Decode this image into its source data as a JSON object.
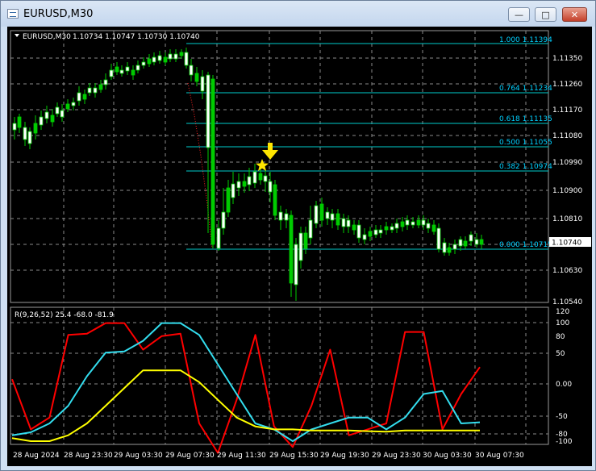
{
  "window": {
    "title": "EURUSD,M30",
    "minimize_icon": "minimize-icon",
    "maximize_icon": "maximize-icon",
    "close_icon": "close-icon"
  },
  "chart": {
    "symbol_header": "EURUSD,M30",
    "ohlc": "1.10734 1.10747 1.10730 1.10740",
    "current_price": "1.10740",
    "price_ticks": [
      "1.11350",
      "1.11260",
      "1.11170",
      "1.11080",
      "1.10990",
      "1.10900",
      "1.10810",
      "1.10720",
      "1.10630",
      "1.10540"
    ],
    "time_ticks": [
      "28 Aug 2024",
      "28 Aug 23:30",
      "29 Aug 03:30",
      "29 Aug 07:30",
      "29 Aug 11:30",
      "29 Aug 15:30",
      "29 Aug 19:30",
      "29 Aug 23:30",
      "30 Aug 03:30",
      "30 Aug 07:30"
    ],
    "fibo_levels": [
      {
        "label": "1.000  1.11394"
      },
      {
        "label": "0.764  1.11234"
      },
      {
        "label": "0.618  1.11135"
      },
      {
        "label": "0.500  1.11055"
      },
      {
        "label": "0.382  1.10974"
      },
      {
        "label": "0.000  1.10715"
      }
    ],
    "indicator_label": "R(9,26,52) 25.4 -68.0 -81.9",
    "indicator_ticks": [
      "120",
      "100",
      "80",
      "50",
      "0.00",
      "-50",
      "-80",
      "-100"
    ],
    "colors": {
      "bull": "#ffffff",
      "bear": "#00cc00",
      "fibo": "#00cccc",
      "grid": "#8a8a8a",
      "red": "#ff0000",
      "cyan": "#33ddee",
      "yellow": "#ffff00",
      "marker": "#ffe600"
    }
  },
  "chart_data": [
    {
      "type": "candlestick",
      "title": "EURUSD,M30",
      "ylim": [
        1.105,
        1.1141
      ],
      "values_close_approx": [
        1.1114,
        1.1109,
        1.1121,
        1.1128,
        1.1136,
        1.1133,
        1.1129,
        1.1125,
        1.1113,
        1.1098,
        1.1092,
        1.1096,
        1.1086,
        1.1078,
        1.1083,
        1.109,
        1.1082,
        1.108,
        1.1078,
        1.1079,
        1.1076,
        1.1074
      ]
    },
    {
      "type": "line",
      "series": [
        {
          "name": "",
          "values": [
            5,
            -80,
            -60,
            80,
            82,
            100,
            100,
            55,
            78,
            82,
            -70,
            -120,
            -30,
            80,
            -75,
            -110,
            -40,
            55,
            -90,
            -80,
            -70,
            85,
            85,
            -80,
            -20,
            25.4
          ]
        },
        {
          "name": "",
          "values": [
            -90,
            -85,
            -70,
            -40,
            10,
            50,
            52,
            70,
            100,
            100,
            80,
            30,
            -20,
            -70,
            -80,
            -100,
            -80,
            -70,
            -60,
            -60,
            -80,
            -60,
            -20,
            -15,
            -70,
            -68.0
          ]
        },
        {
          "name": "",
          "values": [
            -95,
            -100,
            -100,
            -90,
            -70,
            -40,
            -10,
            20,
            20,
            20,
            0,
            -30,
            -60,
            -75,
            -80,
            -80,
            -82,
            -82,
            -82,
            -83,
            -84,
            -82,
            -82,
            -82,
            -82,
            -81.9
          ]
        }
      ],
      "ylim": [
        -100,
        120
      ]
    }
  ]
}
